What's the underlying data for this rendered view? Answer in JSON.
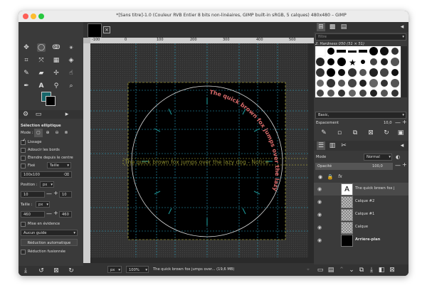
{
  "window": {
    "title": "*[Sans titre]-1.0 (Couleur RVB Entier 8 bits non-linéaires, GIMP built-in sRGB, 5 calques) 480x480 – GIMP"
  },
  "tool_options": {
    "title": "Sélection elliptique",
    "mode_label": "Mode :",
    "antialias": "Lissage",
    "feather": "Adoucir les bords",
    "expand_center": "Étendre depuis le centre",
    "fixed_label": "Fixé",
    "fixed_option": "Taille",
    "size_value": "100x100",
    "position_label": "Position :",
    "unit": "px",
    "pos_x": "10",
    "pos_y": "10",
    "size_label": "Taille :",
    "size_w": "460",
    "size_h": "460",
    "highlight": "Mise en évidence",
    "guides": "Aucun guide",
    "auto_shrink": "Réduction automatique",
    "merged": "Réduction fusionnée"
  },
  "canvas": {
    "ruler_labels": [
      "-100",
      "0",
      "100",
      "200",
      "300",
      "400",
      "500"
    ],
    "arc_text": "The quick brown fox jumps over the lazy dog - Notice",
    "guide_text": "The quick brown fox jumps over the lazy dog - Notice"
  },
  "status": {
    "unit": "px",
    "zoom": "100%",
    "message": "The quick brown fox jumps over... (19,6 MB)"
  },
  "brushes": {
    "filter_placeholder": "filtre",
    "name": "2. Hardness 050 (51 × 51)",
    "preset": "Basic,",
    "spacing_label": "Espacement",
    "spacing_value": "10,0"
  },
  "layers": {
    "mode_label": "Mode",
    "mode_value": "Normal",
    "opacity_label": "Opacité",
    "opacity_value": "100,0",
    "items": [
      {
        "name": "The quick brown fox j",
        "kind": "text"
      },
      {
        "name": "Calque #2",
        "kind": "transparent"
      },
      {
        "name": "Calque #1",
        "kind": "transparent"
      },
      {
        "name": "Calque",
        "kind": "transparent"
      },
      {
        "name": "Arrière-plan",
        "kind": "black"
      }
    ]
  },
  "colors": {
    "foreground": "#17666a",
    "background": "#000000",
    "guide": "#29a8c8",
    "arc_text": "#d96a6a"
  }
}
